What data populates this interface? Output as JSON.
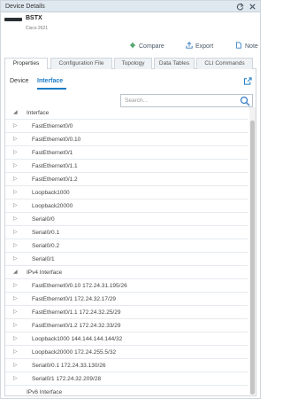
{
  "window": {
    "title": "Device Details"
  },
  "device": {
    "name": "BSTX",
    "model": "Cisco 2621"
  },
  "actions": {
    "compare": "Compare",
    "export": "Export",
    "note": "Note"
  },
  "tabs": [
    {
      "label": "Properties"
    },
    {
      "label": "Configuration File"
    },
    {
      "label": "Topology"
    },
    {
      "label": "Data Tables"
    },
    {
      "label": "CLI Commands"
    }
  ],
  "subtabs": {
    "device": "Device",
    "interface": "Interface"
  },
  "search": {
    "placeholder": "Search..."
  },
  "tree": {
    "groups": [
      {
        "label": "Interface"
      },
      {
        "label": "IPv4 Interface"
      },
      {
        "label": "IPv6 Interface"
      }
    ],
    "interfaces": [
      "FastEthernet0/0",
      "FastEthernet0/0.10",
      "FastEthernet0/1",
      "FastEthernet0/1.1",
      "FastEthernet0/1.2",
      "Loopback1000",
      "Loopback20000",
      "Serial0/0",
      "Serial0/0.1",
      "Serial0/0.2",
      "Serial0/1"
    ],
    "ipv4": [
      "FastEthernet0/0.10 172.24.31.195/26",
      "FastEthernet0/1 172.24.32.17/29",
      "FastEthernet0/1.1 172.24.32.25/29",
      "FastEthernet0/1.2 172.24.32.33/29",
      "Loopback1000 144.144.144.144/32",
      "Loopback20000 172.24.255.5/32",
      "Serial0/0.1 172.24.33.130/26",
      "Serial0/1 172.24.32.209/28"
    ]
  },
  "colors": {
    "accent": "#1b7bc6",
    "titlebar": "#dfe7ef"
  }
}
